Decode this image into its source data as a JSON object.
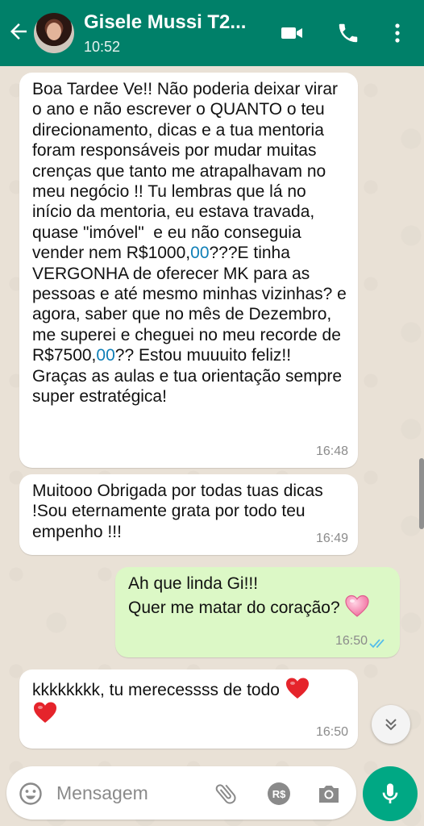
{
  "header": {
    "contact_name": "Gisele Mussi T2...",
    "status": "10:52",
    "icons": [
      "back-arrow-icon",
      "video-call-icon",
      "voice-call-icon",
      "more-options-icon"
    ]
  },
  "messages": [
    {
      "direction": "incoming",
      "text_parts": [
        "Boa Tardee Ve!! Não poderia deixar virar o ano e não escrever o QUANTO o teu direcionamento, dicas e a tua mentoria foram responsáveis por mudar muitas crenças que tanto me atrapalhavam no meu negócio !! Tu lembras que lá no início da mentoria, eu estava travada, quase \"imóvel\"  e eu não conseguia vender nem R$1000,",
        "00",
        "???E tinha VERGONHA de oferecer MK para as pessoas e até mesmo minhas vizinhas? e agora, saber que no mês de Dezembro, me superei e cheguei no meu recorde de R$7500,",
        "00",
        "?? Estou muuuito feliz!! Graças as aulas e tua orientação sempre super estratégica!"
      ],
      "time": "16:48"
    },
    {
      "direction": "incoming",
      "text": "Muitooo Obrigada por todas tuas dicas !Sou eternamente grata por todo teu empenho !!!",
      "time": "16:49"
    },
    {
      "direction": "outgoing",
      "line1": "Ah que linda Gi!!!",
      "line2": "Quer me matar do coração?",
      "emoji": "pink-heart-icon",
      "time": "16:50",
      "status": "read"
    },
    {
      "direction": "incoming",
      "text": "kkkkkkkk, tu merecessss de todo",
      "emoji": "red-heart-icon",
      "time": "16:50"
    }
  ],
  "composer": {
    "placeholder": "Mensagem",
    "icons": [
      "emoji-icon",
      "attach-icon",
      "payment-icon",
      "camera-icon",
      "microphone-icon"
    ],
    "payment_symbol": "R$"
  },
  "colors": {
    "header": "#008069",
    "wallpaper": "#e9e1d6",
    "incoming_bubble": "#ffffff",
    "outgoing_bubble": "#dcf8c6",
    "accent": "#00a884",
    "link": "#0f7fb7",
    "read_ticks": "#53bdeb"
  }
}
